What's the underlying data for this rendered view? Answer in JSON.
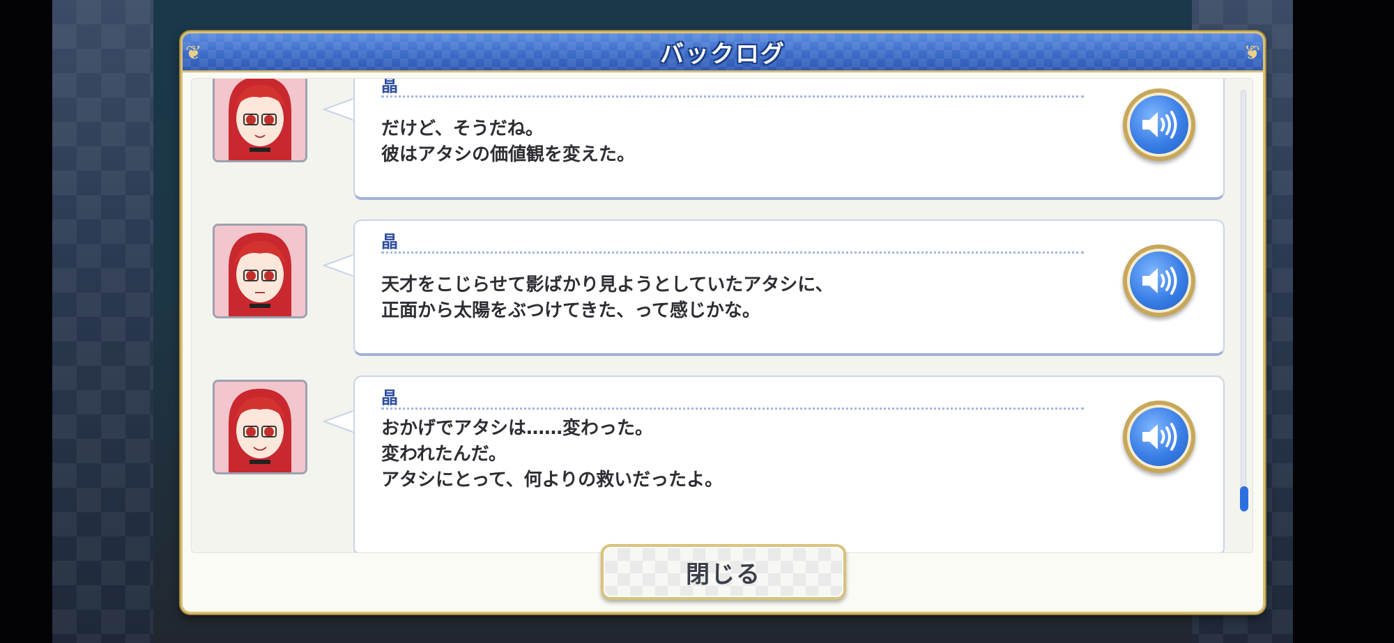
{
  "dialog": {
    "title": "バックログ",
    "close_label": "閉じる"
  },
  "entries": [
    {
      "speaker": "晶",
      "text": "だけど、そうだね。\n彼はアタシの価値観を変えた。",
      "voice_icon": "speaker-icon"
    },
    {
      "speaker": "晶",
      "text": "天才をこじらせて影ばかり見ようとしていたアタシに、\n正面から太陽をぶつけてきた、って感じかな。",
      "voice_icon": "speaker-icon"
    },
    {
      "speaker": "晶",
      "text": "おかげでアタシは……変わった。\n変われたんだ。\nアタシにとって、何よりの救いだったよ。",
      "voice_icon": "speaker-icon"
    }
  ],
  "colors": {
    "title_bar": "#3d6cc8",
    "accent_gold": "#d8c27a",
    "speaker_name": "#2d4f9d",
    "voice_button": "#3a7fe6"
  },
  "scroll": {
    "position_fraction": 1.0
  }
}
